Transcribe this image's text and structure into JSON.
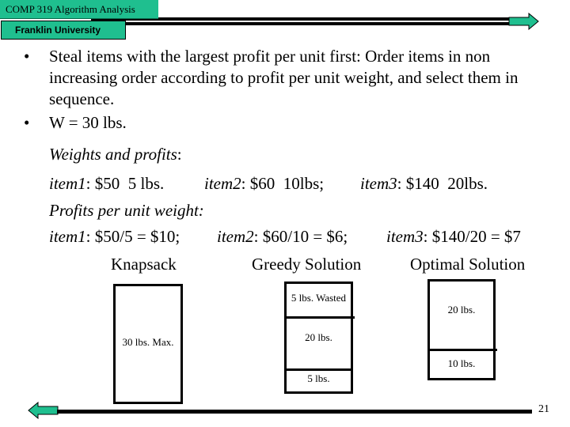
{
  "header": {
    "course": "COMP 319 Algorithm Analysis",
    "university": "Franklin University",
    "colors": {
      "accent": "#1fbf8f",
      "rule": "#000000"
    }
  },
  "nav": {
    "next_icon": "arrow-right-icon",
    "prev_icon": "arrow-left-icon"
  },
  "bullets": [
    "Steal items with the largest profit per unit first: Order items in non increasing order according to profit per unit weight, and select them in sequence.",
    "W = 30 lbs."
  ],
  "weights_heading": "Weights and profits",
  "weights_items": [
    {
      "name": "item1",
      "value": ": $50  5 lbs."
    },
    {
      "name": "item2",
      "value": ": $60  10lbs;"
    },
    {
      "name": "item3",
      "value": ": $140  20lbs."
    }
  ],
  "ppw_heading": "Profits per unit weight:",
  "ppw_items": [
    {
      "name": "item1",
      "value": ": $50/5 = $10;"
    },
    {
      "name": "item2",
      "value": ": $60/10 = $6;"
    },
    {
      "name": "item3",
      "value": ": $140/20 = $7"
    }
  ],
  "columns": {
    "knapsack": "Knapsack",
    "greedy": "Greedy Solution",
    "optimal": "Optimal Solution"
  },
  "knapsack_box": {
    "label": "30 lbs. Max."
  },
  "greedy_box": {
    "segments": [
      "5 lbs. Wasted",
      "20 lbs.",
      "5 lbs."
    ]
  },
  "optimal_box": {
    "segments": [
      "20 lbs.",
      "10 lbs."
    ]
  },
  "footer": {
    "page_number": "21"
  }
}
